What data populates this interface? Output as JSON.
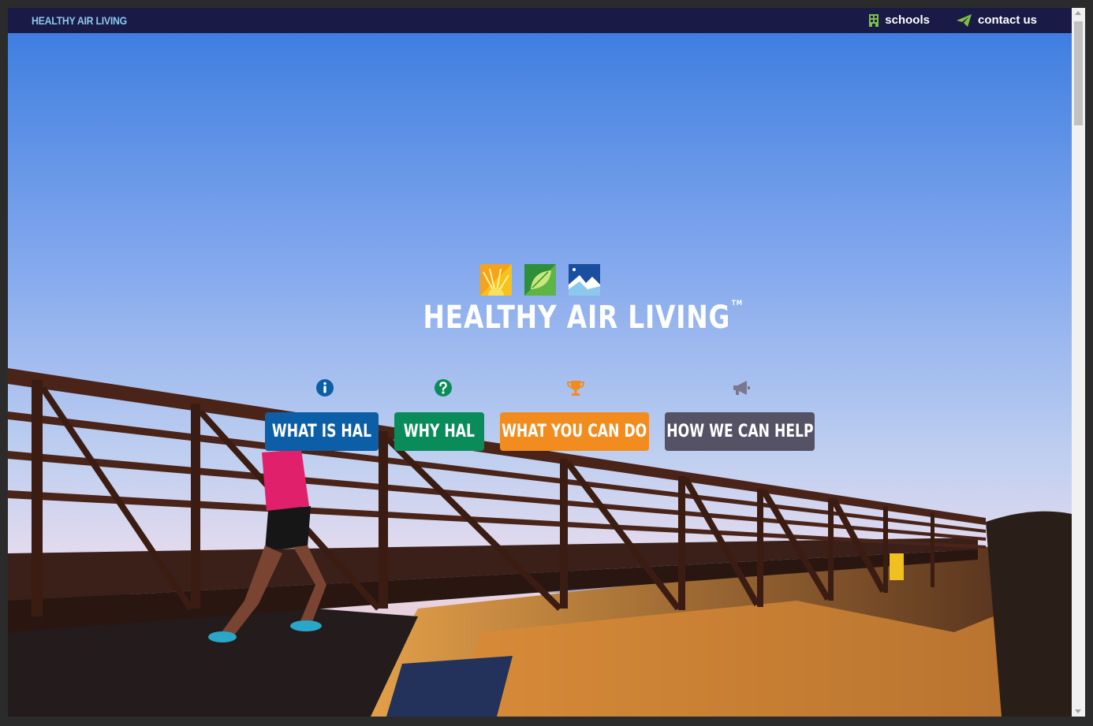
{
  "topbar": {
    "brand": "HEALTHY AIR LIVING",
    "links": [
      {
        "label": "schools",
        "icon": "building-icon"
      },
      {
        "label": "contact us",
        "icon": "paper-plane-icon"
      }
    ]
  },
  "hero": {
    "logo_text": "HEALTHY AIR LIVING",
    "trademark": "TM",
    "logo_icons": [
      "sun-icon",
      "leaf-icon",
      "mountain-icon"
    ]
  },
  "menu": [
    {
      "label": "WHAT IS HAL",
      "icon": "info-icon",
      "color": "#0c5ea7"
    },
    {
      "label": "WHY HAL",
      "icon": "question-icon",
      "color": "#0a8c5a"
    },
    {
      "label": "WHAT YOU CAN DO",
      "icon": "trophy-icon",
      "color": "#f28c1e"
    },
    {
      "label": "HOW WE CAN HELP",
      "icon": "megaphone-icon",
      "color": "#555266"
    }
  ],
  "colors": {
    "topbar": "#1a1a46",
    "brand": "#8ac8f0",
    "schools_icon": "#7cc242",
    "contact_icon": "#7cc242"
  }
}
